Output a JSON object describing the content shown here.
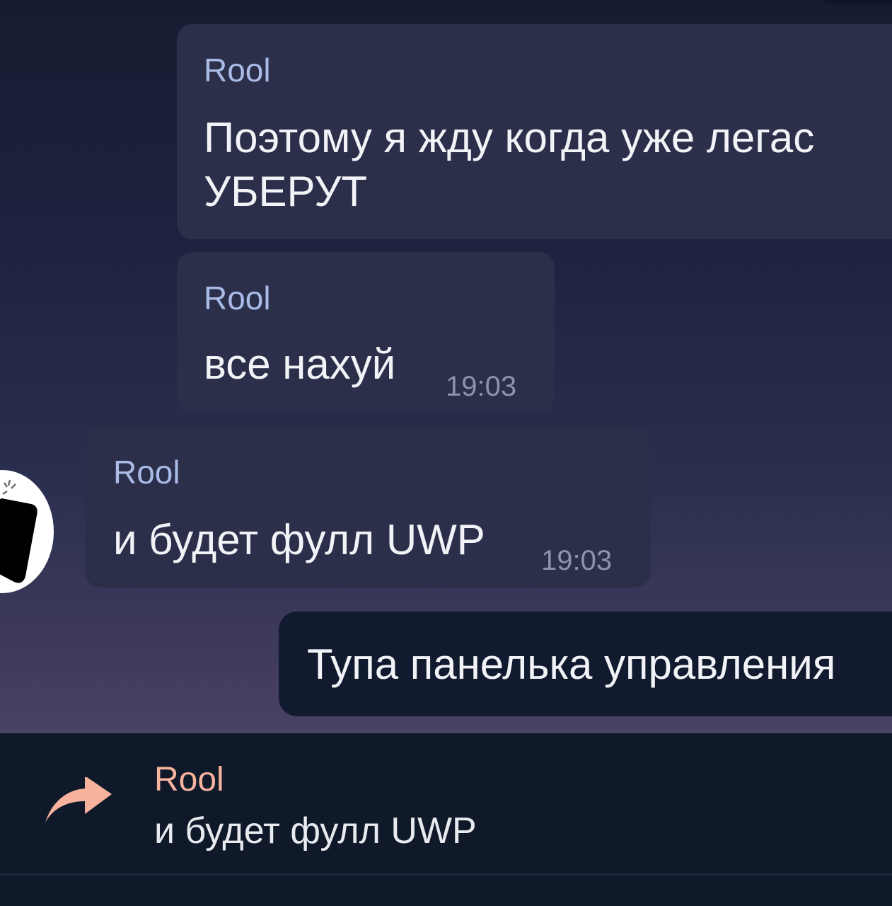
{
  "messages": [
    {
      "sender": "Rool",
      "text_lines": [
        "Поэтому я жду когда уже легас",
        "УБЕРУТ"
      ]
    },
    {
      "sender": "Rool",
      "text": "все нахуй",
      "time": "19:03"
    },
    {
      "sender": "Rool",
      "text": "и будет фулл UWP",
      "time": "19:03"
    }
  ],
  "outgoing": {
    "text": "Тупа панелька управления"
  },
  "reply_preview": {
    "sender": "Rool",
    "text": "и будет фулл UWP",
    "icon": "reply-arrow-icon"
  },
  "colors": {
    "sender_name": "#a9bbe6",
    "reply_accent": "#f7b39e",
    "incoming_bubble": "#2b2f4a",
    "outgoing_bubble": "#111a2e"
  }
}
